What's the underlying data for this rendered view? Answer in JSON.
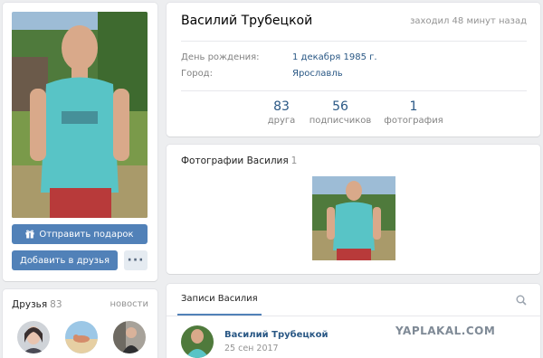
{
  "profile": {
    "name": "Василий Трубецкой",
    "last_seen": "заходил 48 минут назад",
    "birthday_label": "День рождения:",
    "birthday_value": "1 декабря 1985 г.",
    "city_label": "Город:",
    "city_value": "Ярославль"
  },
  "stats": [
    {
      "value": "83",
      "label": "друга"
    },
    {
      "value": "56",
      "label": "подписчиков"
    },
    {
      "value": "1",
      "label": "фотография"
    }
  ],
  "actions": {
    "gift_label": "Отправить подарок",
    "add_friend_label": "Добавить в друзья",
    "more_label": "···"
  },
  "friends": {
    "title": "Друзья",
    "count": "83",
    "news_label": "новости"
  },
  "photos": {
    "title": "Фотографии Василия",
    "count": "1"
  },
  "wall": {
    "tab_label": "Записи Василия",
    "post_author": "Василий Трубецкой",
    "post_date": "25 сен 2017"
  },
  "watermark": "YAPLAKAL.COM",
  "icons": {
    "gift": "gift-icon",
    "search": "search-icon"
  },
  "colors": {
    "accent": "#5181b8",
    "link": "#2a5885",
    "background": "#edeef0"
  }
}
